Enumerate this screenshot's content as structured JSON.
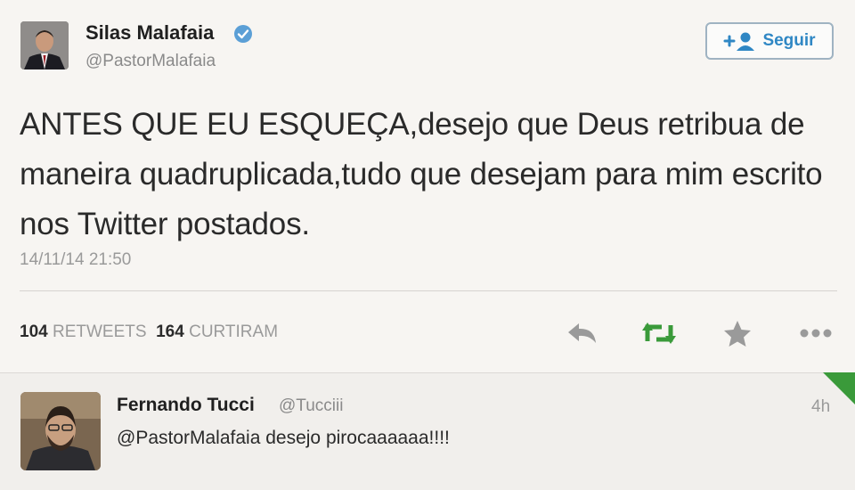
{
  "tweet": {
    "author_name": "Silas Malafaia",
    "author_handle": "@PastorMalafaia",
    "follow_label": "Seguir",
    "text": "ANTES QUE EU ESQUEÇA,desejo que Deus retribua de maneira quadruplicada,tudo que desejam para mim escrito nos Twitter postados.",
    "timestamp": "14/11/14 21:50",
    "retweets_count": "104",
    "retweets_label": "RETWEETS",
    "likes_count": "164",
    "likes_label": "CURTIRAM",
    "icons": [
      "reply-icon",
      "retweet-icon",
      "favorite-star-icon",
      "more-icon"
    ]
  },
  "reply": {
    "author_name": "Fernando Tucci",
    "author_handle": "@Tucciii",
    "time": "4h",
    "text": "@PastorMalafaia desejo pirocaaaaaa!!!!"
  },
  "colors": {
    "link_blue": "#2f87c4",
    "retweet_green": "#3a9a3a",
    "verified_blue": "#5b9fd6",
    "muted_text": "#9a9a9a"
  }
}
